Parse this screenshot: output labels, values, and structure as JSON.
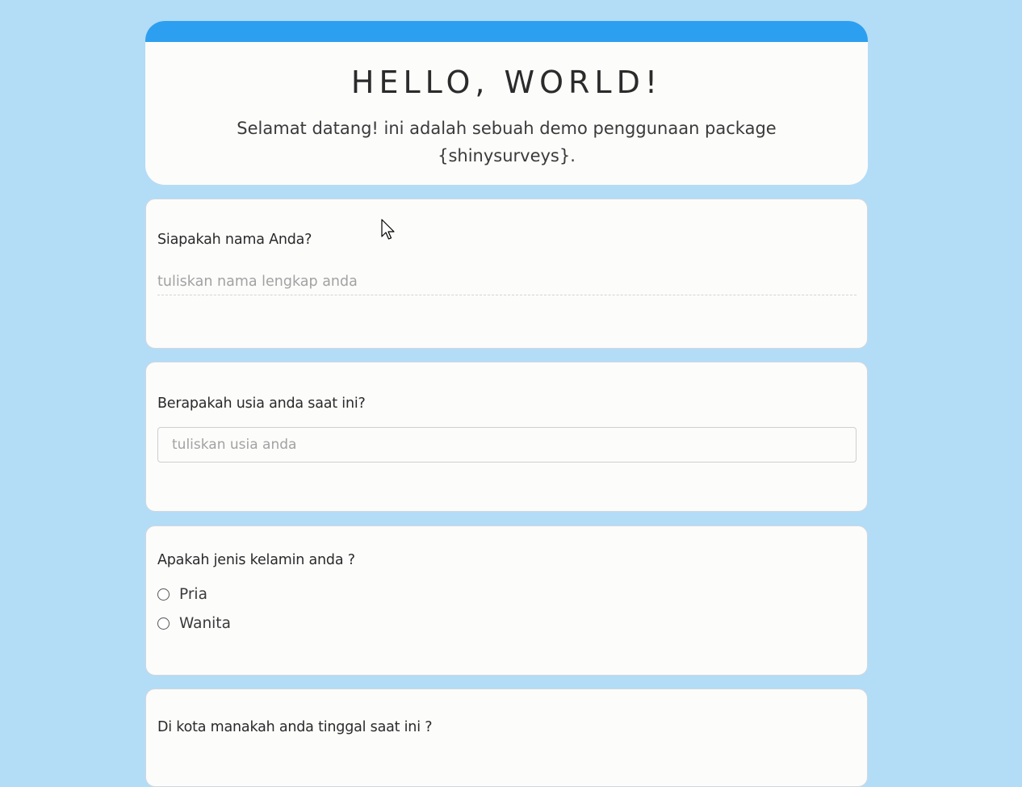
{
  "header": {
    "title": "HELLO, WORLD!",
    "subtitle": "Selamat datang! ini adalah sebuah demo penggunaan package {shinysurveys}.",
    "accent_color": "#2d9ff0"
  },
  "questions": [
    {
      "label": "Siapakah nama Anda?",
      "placeholder": "tuliskan nama lengkap anda",
      "value": ""
    },
    {
      "label": "Berapakah usia anda saat ini?",
      "placeholder": "tuliskan usia anda",
      "value": ""
    },
    {
      "label": "Apakah jenis kelamin anda ?",
      "options": [
        "Pria",
        "Wanita"
      ]
    },
    {
      "label": "Di kota manakah anda tinggal saat ini ?"
    }
  ],
  "page_background": "#b3dcf7"
}
